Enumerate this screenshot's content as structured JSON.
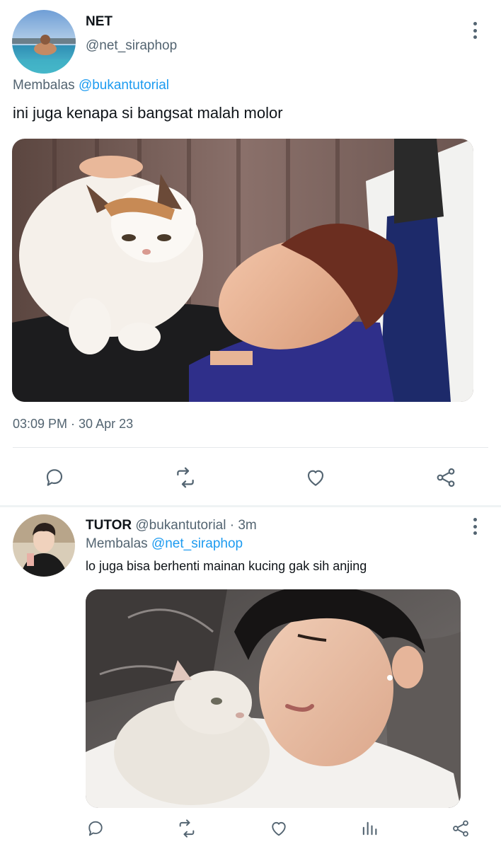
{
  "tweet": {
    "display_name": "NET",
    "handle": "@net_siraphop",
    "replying_prefix": "Membalas",
    "replying_to": "@bukantutorial",
    "text": "ini juga kenapa si bangsat malah molor",
    "timestamp": "03:09 PM · 30 Apr 23",
    "actions": [
      "reply-icon",
      "retweet-icon",
      "like-icon",
      "share-icon"
    ]
  },
  "reply": {
    "display_name": "TUTOR",
    "handle": "@bukantutorial",
    "time": "· 3m",
    "replying_prefix": "Membalas",
    "replying_to": "@net_siraphop",
    "text": "lo juga bisa berhenti mainan kucing gak sih anjing",
    "actions": [
      "reply-icon",
      "retweet-icon",
      "like-icon",
      "views-icon",
      "share-icon"
    ]
  },
  "colors": {
    "text_primary": "#0f1419",
    "text_secondary": "#536471",
    "accent": "#1d9bf0",
    "icon": "#536471"
  }
}
